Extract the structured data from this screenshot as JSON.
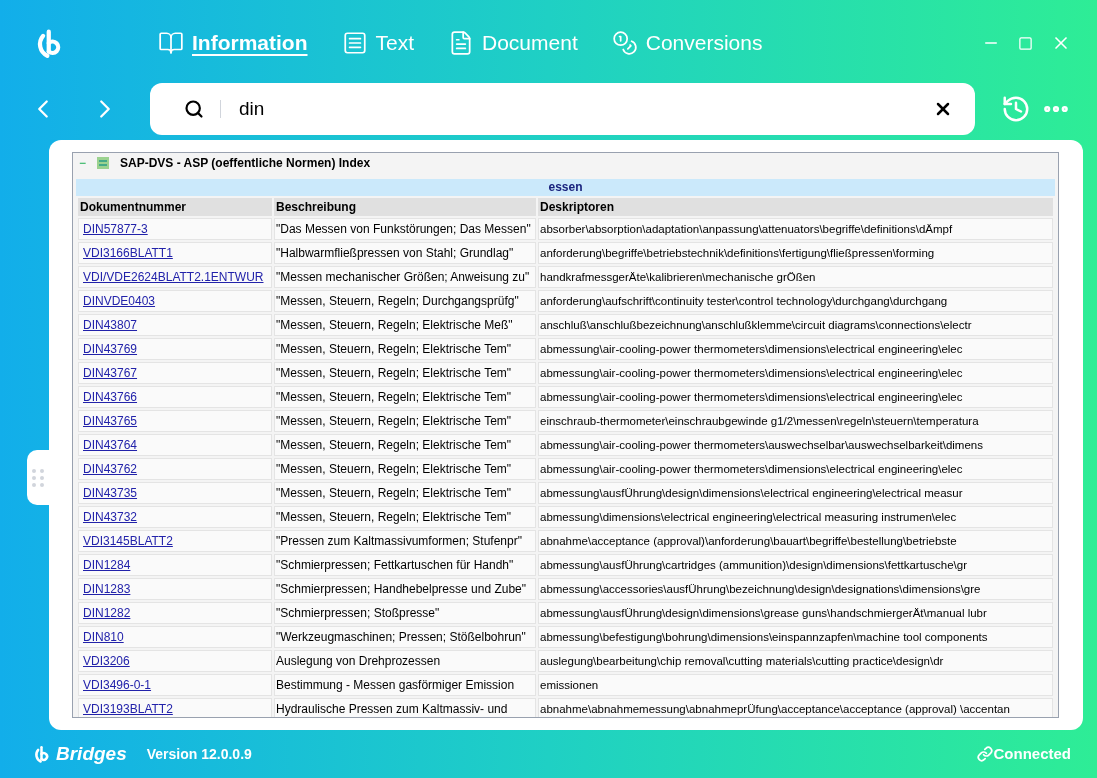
{
  "tabs": [
    {
      "label": "Information",
      "selected": true
    },
    {
      "label": "Text",
      "selected": false
    },
    {
      "label": "Document",
      "selected": false
    },
    {
      "label": "Conversions",
      "selected": false
    }
  ],
  "search": {
    "value": "din"
  },
  "index": {
    "expander": "−",
    "title": "SAP-DVS - ASP (oeffentliche Normen) Index",
    "group": "essen",
    "columns": [
      "Dokumentnummer",
      "Beschreibung",
      "Deskriptoren"
    ],
    "rows": [
      [
        "DIN57877-3",
        "\"Das Messen von Funkstörungen; Das Messen\"",
        "absorber\\absorption\\adaptation\\anpassung\\attenuators\\begriffe\\definitions\\dÄmpf"
      ],
      [
        "VDI3166BLATT1",
        "\"Halbwarmfließpressen von Stahl; Grundlag\"",
        "anforderung\\begriffe\\betriebstechnik\\definitions\\fertigung\\fließpressen\\forming"
      ],
      [
        "VDI/VDE2624BLATT2.1ENTWUR",
        "\"Messen mechanischer Größen; Anweisung zu\"",
        "handkrafmessgerÄte\\kalibrieren\\mechanische grÖßen"
      ],
      [
        "DINVDE0403",
        "\"Messen, Steuern, Regeln; Durchgangsprüfg\"",
        "anforderung\\aufschrift\\continuity tester\\control technology\\durchgang\\durchgang"
      ],
      [
        "DIN43807",
        "\"Messen, Steuern, Regeln; Elektrische Meß\"",
        "anschluß\\anschlußbezeichnung\\anschlußklemme\\circuit diagrams\\connections\\electr"
      ],
      [
        "DIN43769",
        "\"Messen, Steuern, Regeln; Elektrische Tem\"",
        "abmessung\\air-cooling-power thermometers\\dimensions\\electrical engineering\\elec"
      ],
      [
        "DIN43767",
        "\"Messen, Steuern, Regeln; Elektrische Tem\"",
        "abmessung\\air-cooling-power thermometers\\dimensions\\electrical engineering\\elec"
      ],
      [
        "DIN43766",
        "\"Messen, Steuern, Regeln; Elektrische Tem\"",
        "abmessung\\air-cooling-power thermometers\\dimensions\\electrical engineering\\elec"
      ],
      [
        "DIN43765",
        "\"Messen, Steuern, Regeln; Elektrische Tem\"",
        "einschraub-thermometer\\einschraubgewinde g1/2\\messen\\regeln\\steuern\\temperatura"
      ],
      [
        "DIN43764",
        "\"Messen, Steuern, Regeln; Elektrische Tem\"",
        "abmessung\\air-cooling-power thermometers\\auswechselbar\\auswechselbarkeit\\dimens"
      ],
      [
        "DIN43762",
        "\"Messen, Steuern, Regeln; Elektrische Tem\"",
        "abmessung\\air-cooling-power thermometers\\dimensions\\electrical engineering\\elec"
      ],
      [
        "DIN43735",
        "\"Messen, Steuern, Regeln; Elektrische Tem\"",
        "abmessung\\ausfÜhrung\\design\\dimensions\\electrical engineering\\electrical measur"
      ],
      [
        "DIN43732",
        "\"Messen, Steuern, Regeln; Elektrische Tem\"",
        "abmessung\\dimensions\\electrical engineering\\electrical measuring instrumen\\elec"
      ],
      [
        "VDI3145BLATT2",
        "\"Pressen zum Kaltmassivumformen; Stufenpr\"",
        "abnahme\\acceptance (approval)\\anforderung\\bauart\\begriffe\\bestellung\\betriebste"
      ],
      [
        "DIN1284",
        "\"Schmierpressen; Fettkartuschen für Handh\"",
        "abmessung\\ausfÜhrung\\cartridges (ammunition)\\design\\dimensions\\fettkartusche\\gr"
      ],
      [
        "DIN1283",
        "\"Schmierpressen; Handhebelpresse und Zube\"",
        "abmessung\\accessories\\ausfÜhrung\\bezeichnung\\design\\designations\\dimensions\\gre"
      ],
      [
        "DIN1282",
        "\"Schmierpressen; Stoßpresse\"",
        "abmessung\\ausfÜhrung\\design\\dimensions\\grease guns\\handschmiergerÄt\\manual lubr"
      ],
      [
        "DIN810",
        "\"Werkzeugmaschinen; Pressen; Stößelbohrun\"",
        "abmessung\\befestigung\\bohrung\\dimensions\\einspannzapfen\\machine tool components"
      ],
      [
        "VDI3206",
        "Auslegung von Drehprozessen",
        "auslegung\\bearbeitung\\chip removal\\cutting materials\\cutting practice\\design\\dr"
      ],
      [
        "VDI3496-0-1",
        "Bestimmung - Messen gasförmiger Emission",
        "emissionen"
      ],
      [
        "VDI3193BLATT2",
        "Hydraulische Pressen zum Kaltmassiv- und",
        "abnahme\\abnahmemessung\\abnahmeprÜfung\\acceptance\\acceptance (approval) \\accentan"
      ]
    ]
  },
  "footer": {
    "brand": "Bridges",
    "version": "Version 12.0.0.9",
    "status": "Connected"
  }
}
